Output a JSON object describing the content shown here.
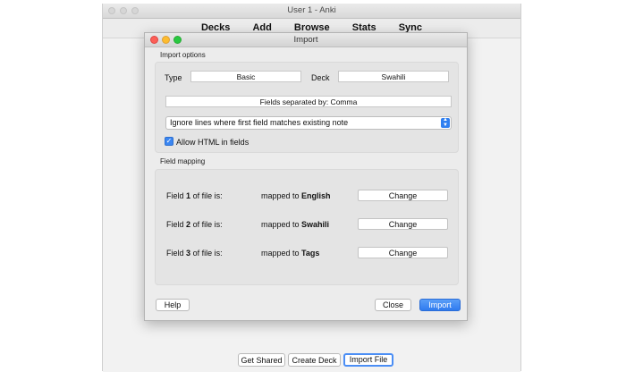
{
  "main_window": {
    "title": "User 1 - Anki",
    "menu": [
      "Decks",
      "Add",
      "Browse",
      "Stats",
      "Sync"
    ],
    "bottom_buttons": {
      "get_shared": "Get Shared",
      "create_deck": "Create Deck",
      "import_file": "Import File"
    }
  },
  "import_dialog": {
    "title": "Import",
    "import_options": {
      "section_label": "Import options",
      "type_label": "Type",
      "type_value": "Basic",
      "deck_label": "Deck",
      "deck_value": "Swahili",
      "separator_text": "Fields separated by: Comma",
      "duplicate_option": "Ignore lines where first field matches existing note",
      "allow_html_label": "Allow HTML in fields",
      "allow_html_checked": true
    },
    "field_mapping": {
      "section_label": "Field mapping",
      "rows": [
        {
          "prefix": "Field",
          "num": "1",
          "suffix": "of file is:",
          "mapped_prefix": "mapped to",
          "target": "English",
          "button": "Change"
        },
        {
          "prefix": "Field",
          "num": "2",
          "suffix": "of file is:",
          "mapped_prefix": "mapped to",
          "target": "Swahili",
          "button": "Change"
        },
        {
          "prefix": "Field",
          "num": "3",
          "suffix": "of file is:",
          "mapped_prefix": "mapped to",
          "target": "Tags",
          "button": "Change"
        }
      ]
    },
    "buttons": {
      "help": "Help",
      "close": "Close",
      "import": "Import"
    }
  },
  "colors": {
    "accent": "#2f7bef",
    "close_light": "#fc5f57",
    "minimize_light": "#fdbc2e",
    "zoom_light": "#28c840"
  }
}
